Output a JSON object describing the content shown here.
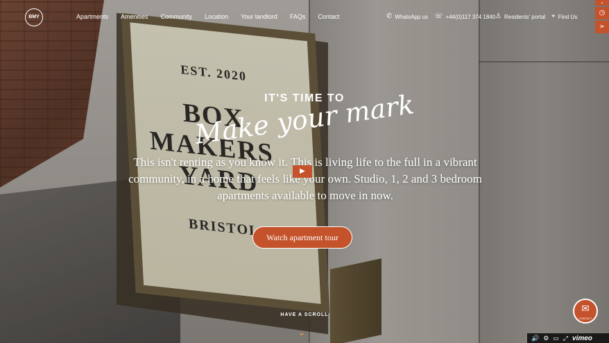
{
  "logo": "BMY",
  "nav": {
    "items": [
      "Apartments",
      "Amenities",
      "Community",
      "Location",
      "Your landlord",
      "FAQs",
      "Contact"
    ]
  },
  "utility": {
    "whatsapp": "WhatsApp us",
    "phone": "+44(0)117 374 1840",
    "portal": "Residents' portal",
    "find": "Find Us"
  },
  "hero": {
    "kicker": "IT'S TIME TO",
    "script": "Make your mark",
    "lead": "This isn't renting as you know it. This is living life to the full in a vibrant community, in a home that feels like your own. Studio, 1, 2 and 3 bedroom apartments available to move in now.",
    "cta": "Watch apartment tour",
    "scroll": "HAVE A SCROLL"
  },
  "sign": {
    "est": "EST. 2020",
    "line1": "BOX",
    "line2": "MAKERS",
    "line3": "YARD",
    "city": "BRISTOL"
  },
  "contact_fab": "CONTACT",
  "video": {
    "brand": "vimeo"
  },
  "icons": {
    "whatsapp": "whatsapp-icon",
    "phone": "phone-icon",
    "portal": "user-icon",
    "find": "map-pin-icon",
    "play": "play-icon",
    "scroll": "chevron-down-icon",
    "contact": "envelope-icon"
  },
  "colors": {
    "accent": "#c4522b",
    "arrow": "#e8a24a"
  }
}
